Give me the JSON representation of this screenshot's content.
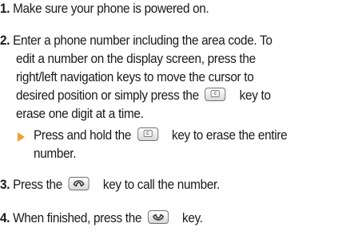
{
  "steps": [
    {
      "number": "1.",
      "lines": [
        "Make sure your phone is powered on."
      ]
    },
    {
      "number": "2.",
      "lines": [
        "Enter a phone number including the area code. To",
        "edit a number on the display screen, press the",
        "right/left navigation keys to move the cursor to",
        "desired position or simply press the",
        "key to",
        "erase one digit at a time."
      ],
      "sub_bullet": {
        "part1": "Press and hold the",
        "part2": "key to erase the entire",
        "part3": "number."
      }
    },
    {
      "number": "3.",
      "part1": "Press the",
      "part2": "key to call the number."
    },
    {
      "number": "4.",
      "part1": "When finished, press the",
      "part2": "key."
    }
  ],
  "icons": {
    "clear_key": "clear-key-icon",
    "send_key": "send-key-icon",
    "end_key": "end-key-icon",
    "bullet": "bullet-arrow-icon"
  },
  "colors": {
    "text": "#1a1a1a",
    "bullet": "#f0a030"
  }
}
